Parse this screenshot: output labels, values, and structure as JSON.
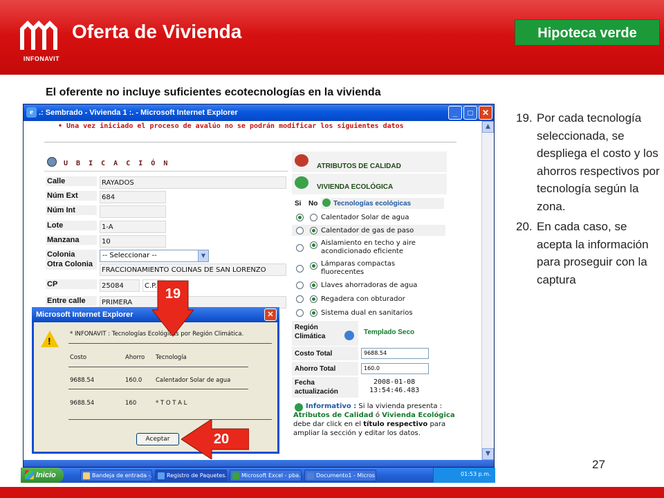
{
  "slide": {
    "title": "Oferta de Vivienda",
    "logo_text": "INFONAVIT",
    "badge": "Hipoteca verde",
    "subtitle": "El oferente no incluye suficientes ecotecnologías en la vivienda",
    "page_number": "27",
    "colors": {
      "header_red": "#d40f0f",
      "badge_green": "#1c9a3a",
      "callout_red": "#e8281a"
    }
  },
  "notes": [
    {
      "num": "19.",
      "text": "Por cada tecnología seleccionada, se despliega el costo y los ahorros respectivos por tecnología según la zona."
    },
    {
      "num": "20.",
      "text": "En cada caso, se acepta la información para proseguir con la captura"
    }
  ],
  "browser": {
    "title": ".: Sembrado - Vivienda 1 :. - Microsoft Internet Explorer",
    "notice": "•  Una vez iniciado el proceso de avalúo no se podrán modificar los siguientes datos"
  },
  "location": {
    "heading": "U B I C A C I Ó N",
    "fields": [
      {
        "label": "Calle",
        "value": "RAYADOS"
      },
      {
        "label": "Núm Ext",
        "value": "684"
      },
      {
        "label": "Núm Int",
        "value": ""
      },
      {
        "label": "Lote",
        "value": "1-A"
      },
      {
        "label": "Manzana",
        "value": "10"
      },
      {
        "label": "Colonia",
        "value": ""
      },
      {
        "label": "Otra Colonia",
        "value": "FRACCIONAMIENTO COLINAS DE SAN LORENZO"
      },
      {
        "label": "CP",
        "value": "25084"
      },
      {
        "label": "Entre calle",
        "value": "PRIMERA"
      }
    ],
    "colonia_select": "-- Seleccionar --",
    "cp_tag": "C.P."
  },
  "quality": {
    "attributes_heading": "ATRIBUTOS DE CALIDAD",
    "eco_heading": "VIVIENDA ECOLÓGICA",
    "col_si": "Si",
    "col_no": "No",
    "tech_heading": "Tecnologías ecológicas",
    "technologies": [
      {
        "label": "Calentador Solar de agua",
        "si": true
      },
      {
        "label": "Calentador de gas de paso",
        "si": false
      },
      {
        "label": "Aislamiento en techo y aire acondicionado eficiente",
        "si": false
      },
      {
        "label": "Lámparas compactas fluorecentes",
        "si": false
      },
      {
        "label": "Llaves ahorradoras de agua",
        "si": false
      },
      {
        "label": "Regadera con obturador",
        "si": false
      },
      {
        "label": "Sistema dual en sanitarios",
        "si": false
      }
    ],
    "region_label": "Región Climática",
    "region_value": "Templado Seco",
    "costo_label": "Costo Total",
    "costo_value": "9688.54",
    "ahorro_label": "Ahorro Total",
    "ahorro_value": "160.0",
    "fecha_label": "Fecha actualización",
    "fecha_date": "2008-01-08",
    "fecha_time": "13:54:46.483",
    "info_label": "Informativo :",
    "info_text1": " Si la vivienda presenta : ",
    "info_attr": "Atributos de Calidad",
    "info_or": " ó ",
    "info_eco": "Vivienda Ecológica",
    "info_text2": " debe dar click en el ",
    "info_title": "título respectivo",
    "info_text3": " para ampliar la sección y editar los datos."
  },
  "dialog": {
    "title": "Microsoft Internet Explorer",
    "header": "* INFONAVIT :  Tecnologías Ecológicas por Región Climática.",
    "columns": {
      "costo": "Costo",
      "ahorro": "Ahorro",
      "tech": "Tecnología"
    },
    "rows": [
      {
        "costo": "9688.54",
        "ahorro": "160.0",
        "tech": "Calentador Solar de agua"
      },
      {
        "costo": "9688.54",
        "ahorro": "160",
        "tech": "* T O T A L"
      }
    ],
    "button": "Aceptar"
  },
  "callouts": {
    "first": "19",
    "second": "20"
  },
  "taskbar": {
    "start": "Inicio",
    "items": [
      "Bandeja de entrada -...",
      "Registro de Paquetes...",
      "Microsoft Excel - pba...",
      "Documento1 - Micros..."
    ],
    "clock": "01:53 p.m."
  }
}
